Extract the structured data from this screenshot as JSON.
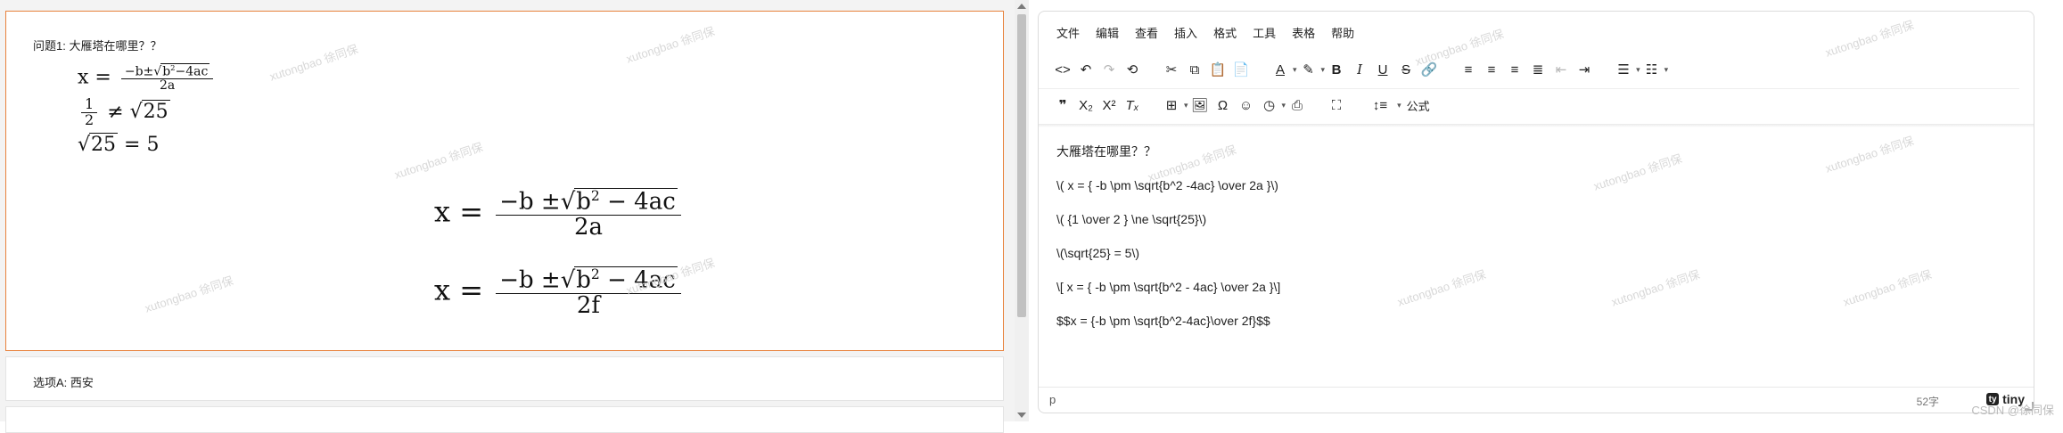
{
  "question": {
    "label": "问题1:  大雁塔在哪里？？",
    "small_formula_1": {
      "lhs": "x =",
      "num_a": "−b±",
      "radicand": "b",
      "exp": "2",
      "rad_rest": "−4ac",
      "den": "2a"
    },
    "small_formula_2": {
      "num": "1",
      "den": "2",
      "rel": "≠",
      "radicand": "25"
    },
    "small_formula_3": {
      "radicand": "25",
      "rhs": "= 5"
    },
    "big_formula_1": {
      "lhs": "x =",
      "num_a": "−b ±",
      "radicand": "b",
      "exp": "2",
      "rad_rest": " − 4ac",
      "den": "2a"
    },
    "big_formula_2": {
      "lhs": "x =",
      "num_a": "−b ±",
      "radicand": "b",
      "exp": "2",
      "rad_rest": " − 4ac",
      "den": "2f"
    }
  },
  "option_a": "选项A:  西安",
  "watermark_text": "xutongbao 徐同保",
  "editor": {
    "menu": [
      "文件",
      "编辑",
      "查看",
      "插入",
      "格式",
      "工具",
      "表格",
      "帮助"
    ],
    "toolbar1": [
      {
        "name": "source-code-icon",
        "glyph": "<>"
      },
      {
        "name": "undo-icon",
        "glyph": "↶"
      },
      {
        "name": "redo-icon",
        "glyph": "↷"
      },
      {
        "name": "restore-draft-icon",
        "glyph": "⟲"
      },
      {
        "name": "cut-icon",
        "glyph": "✂"
      },
      {
        "name": "copy-icon",
        "glyph": "⧉"
      },
      {
        "name": "paste-icon",
        "glyph": "📋"
      },
      {
        "name": "paste-text-icon",
        "glyph": "📄"
      },
      {
        "name": "font-color-icon",
        "glyph": "A"
      },
      {
        "name": "highlight-color-icon",
        "glyph": "✎"
      },
      {
        "name": "bold-icon",
        "glyph": "B"
      },
      {
        "name": "italic-icon",
        "glyph": "I"
      },
      {
        "name": "underline-icon",
        "glyph": "U"
      },
      {
        "name": "strikethrough-icon",
        "glyph": "S"
      },
      {
        "name": "link-icon",
        "glyph": "🔗"
      },
      {
        "name": "align-left-icon",
        "glyph": "≡"
      },
      {
        "name": "align-center-icon",
        "glyph": "≡"
      },
      {
        "name": "align-right-icon",
        "glyph": "≡"
      },
      {
        "name": "align-justify-icon",
        "glyph": "≣"
      },
      {
        "name": "outdent-icon",
        "glyph": "⇤"
      },
      {
        "name": "indent-icon",
        "glyph": "⇥"
      },
      {
        "name": "bullet-list-icon",
        "glyph": "☰"
      },
      {
        "name": "numbered-list-icon",
        "glyph": "☷"
      }
    ],
    "toolbar2": [
      {
        "name": "blockquote-icon",
        "glyph": "❞"
      },
      {
        "name": "subscript-icon",
        "glyph": "X₂"
      },
      {
        "name": "superscript-icon",
        "glyph": "X²"
      },
      {
        "name": "clear-format-icon",
        "glyph": "Tₓ"
      },
      {
        "name": "table-icon",
        "glyph": "⊞"
      },
      {
        "name": "image-icon",
        "glyph": "🖼"
      },
      {
        "name": "special-char-icon",
        "glyph": "Ω"
      },
      {
        "name": "emoticons-icon",
        "glyph": "☺"
      },
      {
        "name": "datetime-icon",
        "glyph": "◷"
      },
      {
        "name": "print-icon",
        "glyph": "⎙"
      },
      {
        "name": "fullscreen-icon",
        "glyph": "⛶"
      },
      {
        "name": "line-height-icon",
        "glyph": "↕≡"
      }
    ],
    "formula_button": "公式",
    "content": [
      "大雁塔在哪里？？",
      "\\( x = { -b  \\pm \\sqrt{b^2 -4ac} \\over 2a }\\)",
      "\\( {1 \\over 2 } \\ne \\sqrt{25}\\)",
      "\\(\\sqrt{25} = 5\\)",
      "\\[ x = { -b \\pm \\sqrt{b^2 - 4ac} \\over 2a }\\]",
      "$$x = {-b \\pm \\sqrt{b^2-4ac}\\over 2f}$$"
    ],
    "status_path": "p",
    "word_count": "52字",
    "brand": "tiny",
    "brand_badge": "ty"
  },
  "footer_credit": "CSDN @徐同保"
}
